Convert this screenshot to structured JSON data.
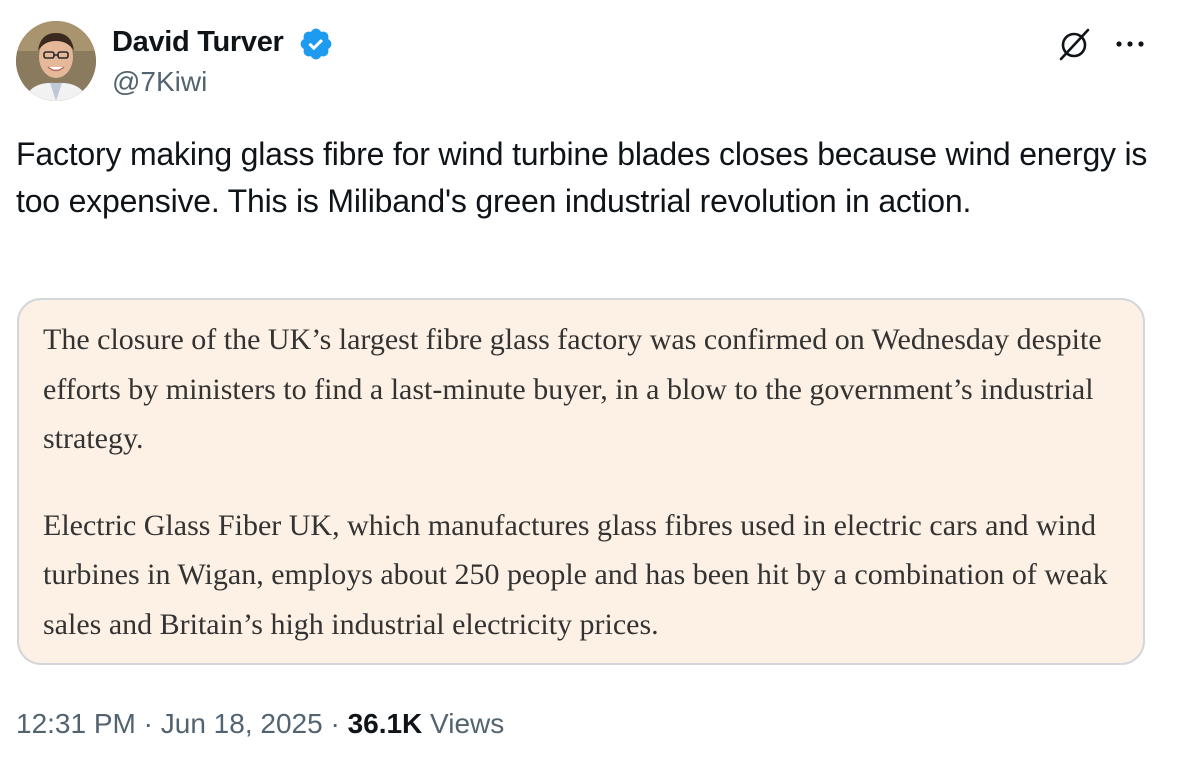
{
  "author": {
    "name": "David Turver",
    "handle": "@7Kiwi",
    "verified": true,
    "verified_color": "#1d9bf0",
    "avatar_icon": "profile-photo"
  },
  "header_actions": {
    "grok_icon": "grok-icon",
    "more_icon": "more-horizontal-icon"
  },
  "tweet": {
    "text": "Factory making glass fibre for wind turbine blades closes because wind energy is too expensive. This is Miliband's green industrial revolution in action."
  },
  "quote": {
    "background": "#fdf1e6",
    "paragraphs": [
      "The closure of the UK’s largest fibre glass factory was confirmed on Wednesday despite efforts by ministers to find a last-minute buyer, in a blow to the government’s industrial strategy.",
      "Electric Glass Fiber UK, which manufactures glass fibres used in electric cars and wind turbines in Wigan, employs about 250 people and has been hit by a combination of weak sales and Britain’s high industrial electricity prices."
    ]
  },
  "meta": {
    "time": "12:31 PM",
    "separator": " · ",
    "date": "Jun 18, 2025",
    "views_count": "36.1K",
    "views_label": " Views"
  }
}
